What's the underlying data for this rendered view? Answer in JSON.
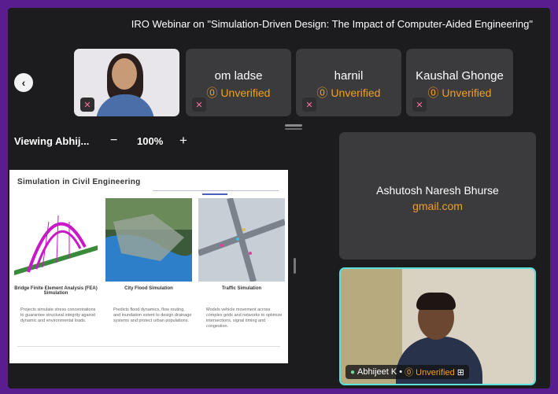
{
  "meeting": {
    "title": "IRO Webinar on \"Simulation-Driven Design: The Impact of Computer-Aided Engineering\""
  },
  "participants": [
    {
      "name": "om ladse",
      "status": "⓪ Unverified"
    },
    {
      "name": "harnil",
      "status": "⓪ Unverified"
    },
    {
      "name": "Kaushal Ghonge",
      "status": "⓪ Unverified"
    }
  ],
  "viewer": {
    "label": "Viewing Abhij...",
    "zoom": "100%",
    "minus": "−",
    "plus": "+"
  },
  "slide": {
    "title": "Simulation in Civil Engineering",
    "items": [
      {
        "caption": "Bridge Finite Element Analysis (FEA) Simulation",
        "desc": "Projects simulate stress concentrations to guarantee structural integrity against dynamic and environmental loads."
      },
      {
        "caption": "City Flood Simulation",
        "desc": "Predicts flood dynamics, flow routing, and inundation extent to design drainage systems and protect urban populations."
      },
      {
        "caption": "Traffic Simulation",
        "desc": "Models vehicle movement across complex grids and networks to optimize intersections, signal timing and congestion."
      }
    ]
  },
  "big_tile": {
    "name": "Ashutosh Naresh Bhurse",
    "email": "gmail.com"
  },
  "active_speaker": {
    "name": "Abhijeet K •",
    "status": "⓪ Unverified"
  },
  "colors": {
    "frame_border": "#5a1d8f",
    "unverified": "#f0a020",
    "active_border": "#5be0dc"
  }
}
